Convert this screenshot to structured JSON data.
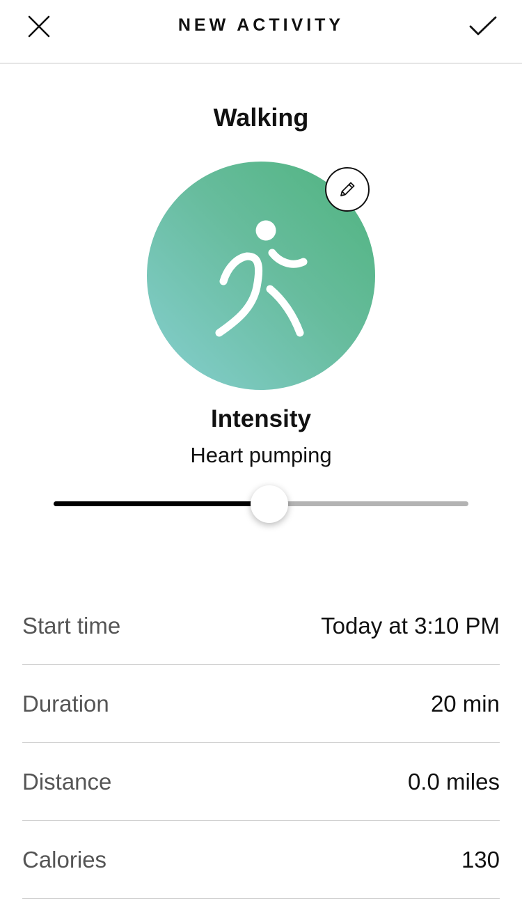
{
  "header": {
    "title": "NEW ACTIVITY",
    "close_icon": "close-icon",
    "save_icon": "checkmark-icon"
  },
  "activity": {
    "name": "Walking",
    "icon": "walking-person-icon",
    "edit_icon": "pencil-icon",
    "colors": {
      "gradient_start": "#4fb37e",
      "gradient_end": "#86cfd0"
    }
  },
  "intensity": {
    "label": "Intensity",
    "value": "Heart pumping",
    "slider_level": 0.52,
    "colors": {
      "filled": "#000000",
      "unfilled": "#b3b3b3"
    }
  },
  "details": [
    {
      "label": "Start time",
      "value": "Today at 3:10 PM"
    },
    {
      "label": "Duration",
      "value": "20 min"
    },
    {
      "label": "Distance",
      "value": "0.0 miles"
    },
    {
      "label": "Calories",
      "value": "130"
    }
  ]
}
